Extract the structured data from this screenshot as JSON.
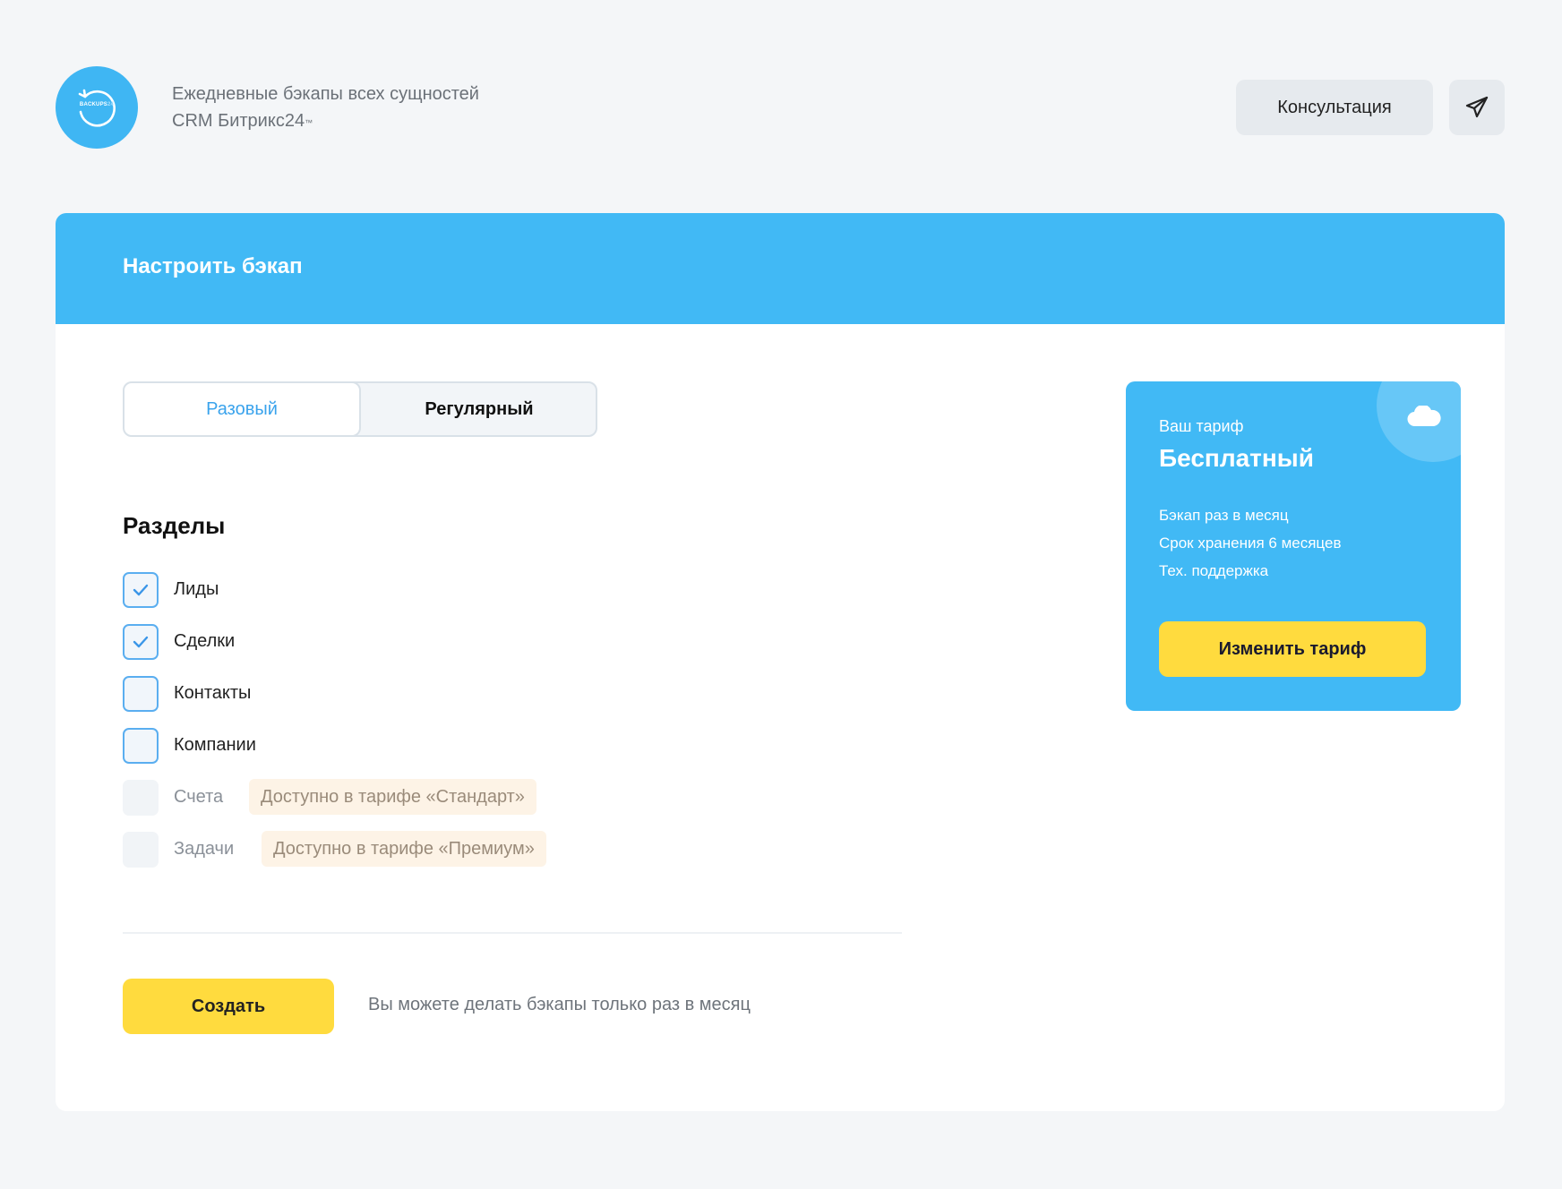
{
  "header": {
    "logo_text_main": "BACKUPS",
    "logo_text_accent": "24",
    "tagline_line1": "Ежедневные бэкапы всех сущностей",
    "tagline_line2": "CRM Битрикс24",
    "tagline_trademark": "™",
    "consult_label": "Консультация",
    "telegram_icon": "paper-plane-icon"
  },
  "card": {
    "title": "Настроить бэкап",
    "tabs": [
      {
        "label": "Разовый",
        "active": true
      },
      {
        "label": "Регулярный",
        "active": false
      }
    ],
    "sections_title": "Разделы",
    "sections": [
      {
        "label": "Лиды",
        "checked": true,
        "enabled": true
      },
      {
        "label": "Сделки",
        "checked": true,
        "enabled": true
      },
      {
        "label": "Контакты",
        "checked": false,
        "enabled": true
      },
      {
        "label": "Компании",
        "checked": false,
        "enabled": true
      },
      {
        "label": "Счета",
        "checked": false,
        "enabled": false,
        "badge": "Доступно в тарифе «Стандарт»"
      },
      {
        "label": "Задачи",
        "checked": false,
        "enabled": false,
        "badge": "Доступно в тарифе «Премиум»"
      }
    ],
    "create_label": "Создать",
    "note": "Вы можете делать бэкапы только раз в месяц"
  },
  "tariff": {
    "label": "Ваш тариф",
    "name": "Бесплатный",
    "features": [
      "Бэкап раз в месяц",
      "Срок хранения 6 месяцев",
      "Тех. поддержка"
    ],
    "change_label": "Изменить тариф",
    "icon": "cloud-icon"
  },
  "colors": {
    "accent_blue": "#41b9f5",
    "button_yellow": "#ffdb3e",
    "badge_bg": "#fdf3e6"
  }
}
